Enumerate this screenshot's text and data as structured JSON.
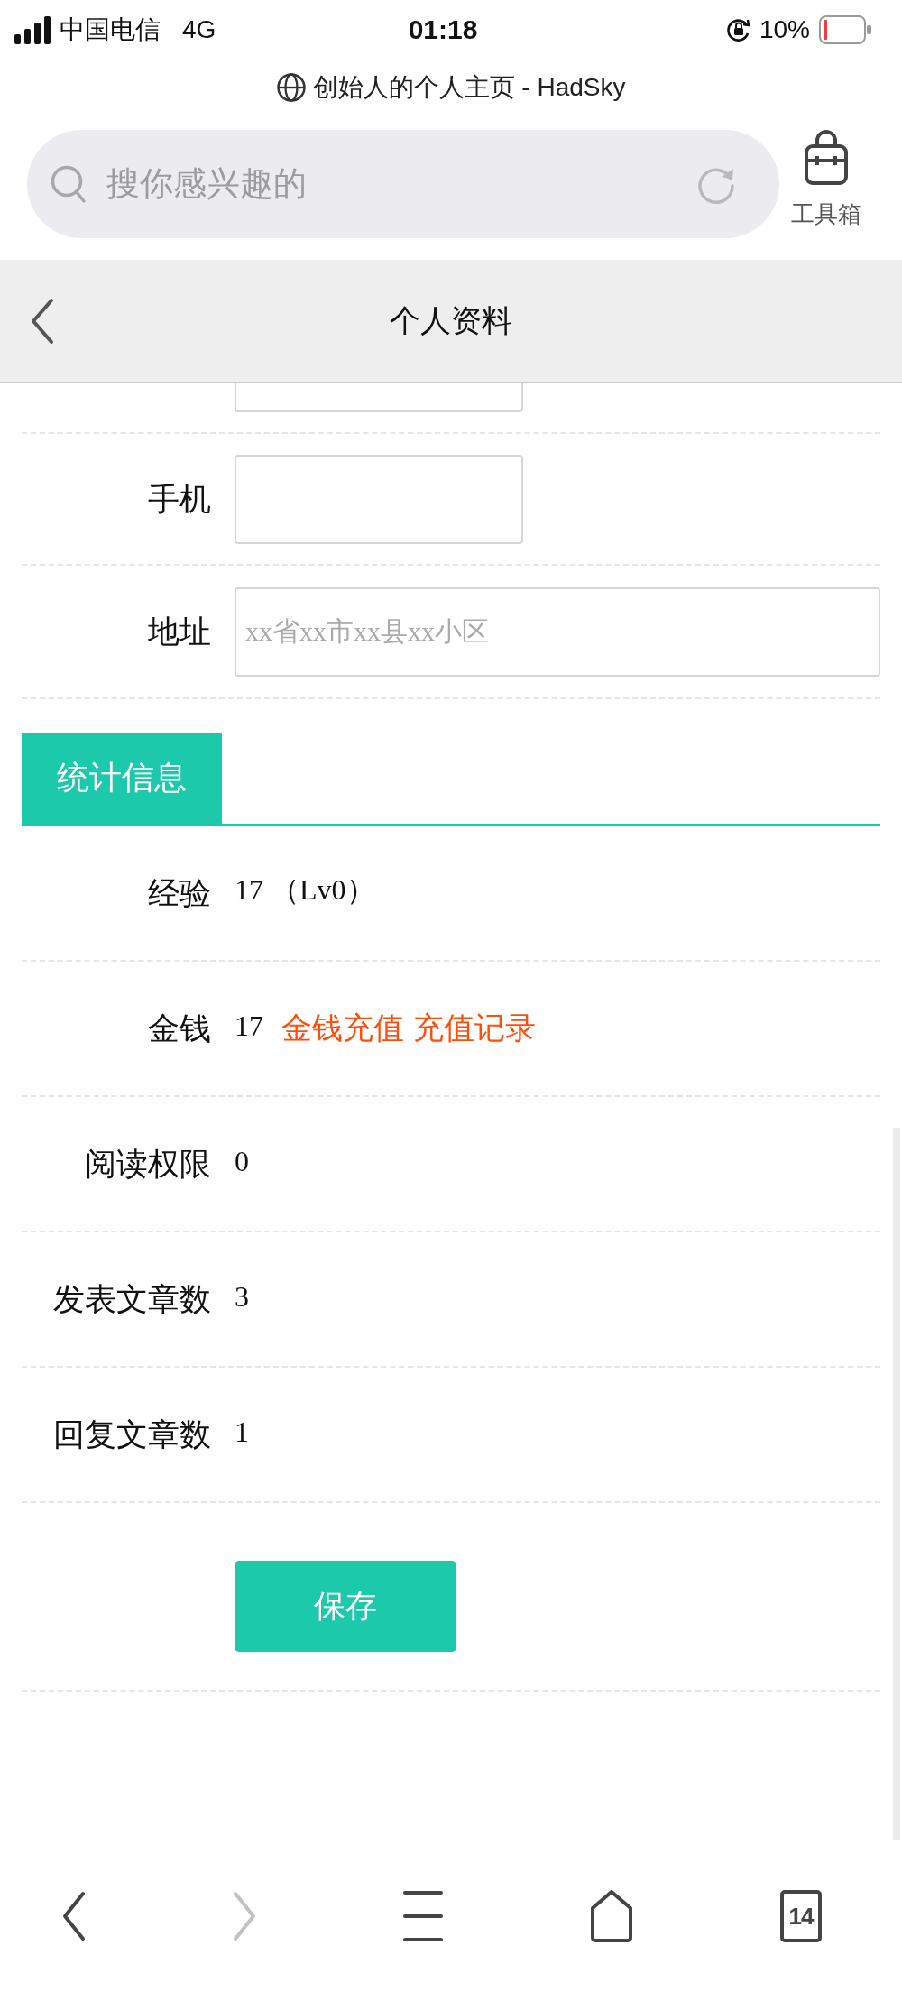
{
  "status_bar": {
    "carrier": "中国电信",
    "network": "4G",
    "time": "01:18",
    "battery": "10%"
  },
  "browser": {
    "page_title": "创始人的个人主页 - HadSky",
    "search": {
      "placeholder": "搜你感兴趣的"
    },
    "toolbox_label": "工具箱"
  },
  "header": {
    "title": "个人资料"
  },
  "profile_fields": [
    {
      "kind": "clipped"
    },
    {
      "kind": "short",
      "label": "手机"
    },
    {
      "kind": "long",
      "label": "地址",
      "placeholder": "xx省xx市xx县xx小区"
    }
  ],
  "stats": {
    "title": "统计信息",
    "rows": [
      {
        "label": "经验",
        "value": "17 （Lv0）"
      },
      {
        "label": "金钱",
        "value": "17",
        "links": [
          "金钱充值",
          "充值记录"
        ]
      },
      {
        "label": "阅读权限",
        "value": "0"
      },
      {
        "label": "发表文章数",
        "value": "3"
      },
      {
        "label": "回复文章数",
        "value": "1"
      }
    ]
  },
  "save_button": "保存",
  "bottom_bar": {
    "buttons": [
      {
        "kind": "back",
        "disabled": false
      },
      {
        "kind": "forward",
        "disabled": true
      },
      {
        "kind": "menu",
        "disabled": false
      },
      {
        "kind": "home",
        "disabled": false
      },
      {
        "kind": "tabs",
        "count": "14",
        "disabled": false
      }
    ]
  }
}
